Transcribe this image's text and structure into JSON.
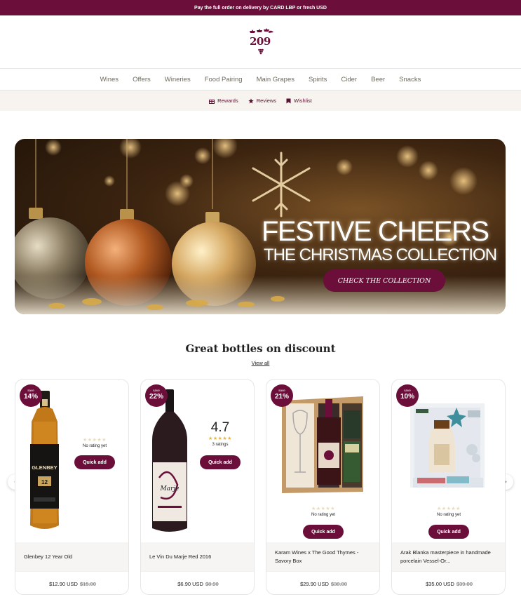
{
  "announcement": "Pay the full order on delivery by CARD LBP or fresh USD",
  "logo": {
    "number": "209"
  },
  "main_nav": [
    "Wines",
    "Offers",
    "Wineries",
    "Food Pairing",
    "Main Grapes",
    "Spirits",
    "Cider",
    "Beer",
    "Snacks"
  ],
  "sub_nav": [
    {
      "label": "Rewards",
      "icon": "gift-icon"
    },
    {
      "label": "Reviews",
      "icon": "star-icon"
    },
    {
      "label": "Wishlist",
      "icon": "bookmark-icon"
    }
  ],
  "banner": {
    "headline": "FESTIVE CHEERS",
    "subheadline": "THE CHRISTMAS COLLECTION",
    "cta": "CHECK THE COLLECTION"
  },
  "section": {
    "title": "Great bottles on discount",
    "view_all": "View all"
  },
  "carousel": {
    "prev": "‹",
    "next": "›"
  },
  "products": [
    {
      "name": "Glenbey 12 Year Old",
      "discount_label": "save",
      "discount": "14%",
      "price": "$12.90 USD",
      "old_price": "$15.00",
      "rating": "",
      "rating_text": "No rating yet",
      "stars": "★★★★★",
      "quick_add": "Quick add"
    },
    {
      "name": "Le Vin Du Marje Red 2016",
      "discount_label": "save",
      "discount": "22%",
      "price": "$6.90 USD",
      "old_price": "$8.90",
      "rating": "4.7",
      "rating_text": "3 ratings",
      "stars": "★★★★★",
      "quick_add": "Quick add"
    },
    {
      "name": "Karam Wines x The Good Thymes - Savory Box",
      "discount_label": "save",
      "discount": "21%",
      "price": "$29.90 USD",
      "old_price": "$38.00",
      "rating": "",
      "rating_text": "No rating yet",
      "stars": "★★★★★",
      "quick_add": "Quick add"
    },
    {
      "name": "Arak Blanka masterpiece in handmade porcelain Vessel-Or...",
      "discount_label": "save",
      "discount": "10%",
      "price": "$35.00 USD",
      "old_price": "$39.00",
      "rating": "",
      "rating_text": "No rating yet",
      "stars": "★★★★★",
      "quick_add": "Quick add"
    }
  ],
  "colors": {
    "brand": "#6b0f3a",
    "nav_text": "#6e6a5a",
    "subnav_bg": "#f7f4f0"
  }
}
